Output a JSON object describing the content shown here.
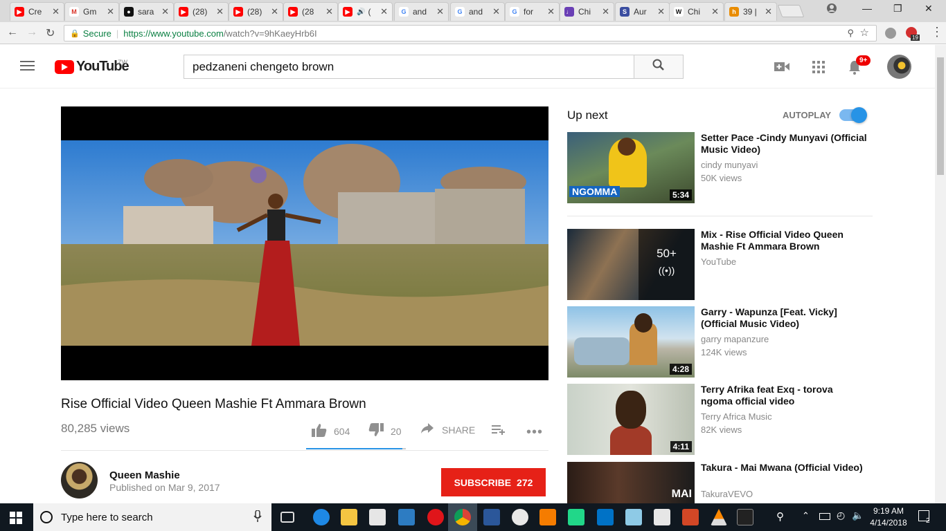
{
  "browser": {
    "tabs": [
      {
        "title": "Cre",
        "fav": "youtube-red"
      },
      {
        "title": "Gm",
        "fav": "gmail"
      },
      {
        "title": "sara",
        "fav": "github"
      },
      {
        "title": "(28)",
        "fav": "youtube-red"
      },
      {
        "title": "(28)",
        "fav": "youtube-red"
      },
      {
        "title": "(28",
        "fav": "youtube-red"
      },
      {
        "title": "(",
        "fav": "youtube-red"
      },
      {
        "title": "and",
        "fav": "google"
      },
      {
        "title": "and",
        "fav": "google"
      },
      {
        "title": "for",
        "fav": "google"
      },
      {
        "title": "Chi",
        "fav": "purple"
      },
      {
        "title": "Aur",
        "fav": "s-blue"
      },
      {
        "title": "Chi",
        "fav": "wikipedia"
      },
      {
        "title": "39 |",
        "fav": "orange"
      }
    ],
    "secure_label": "Secure",
    "url_host": "https://www.youtube.com",
    "url_path": "/watch?v=9hKaeyHrb6I",
    "ext_badge": "19"
  },
  "youtube": {
    "logo_text": "YouTube",
    "country": "ZW",
    "search_value": "pedzaneni chengeto brown",
    "notif_count": "9+"
  },
  "video": {
    "title": "Rise Official Video Queen Mashie Ft Ammara Brown",
    "views": "80,285 views",
    "likes": "604",
    "dislikes": "20",
    "share_label": "SHARE",
    "like_ratio": 0.968,
    "channel": "Queen Mashie",
    "published": "Published on Mar 9, 2017",
    "subscribe_label": "SUBSCRIBE",
    "subscribers": "272"
  },
  "sidebar": {
    "up_next_label": "Up next",
    "autoplay_label": "AUTOPLAY",
    "autoplay_on": true,
    "items": [
      {
        "title": "Setter Pace -Cindy Munyavi (Official Music Video)",
        "channel": "cindy munyavi",
        "views": "50K views",
        "duration": "5:34",
        "thumb_text": "NGOMMA"
      },
      {
        "title": "Mix - Rise Official Video Queen Mashie Ft Ammara Brown",
        "channel": "YouTube",
        "views": "",
        "duration": "",
        "playlist_count": "50+"
      },
      {
        "title": "Garry - Wapunza [Feat. Vicky] (Official Music Video)",
        "channel": "garry mapanzure",
        "views": "124K views",
        "duration": "4:28"
      },
      {
        "title": "Terry Afrika feat Exq - torova ngoma official video",
        "channel": "Terry Africa Music",
        "views": "82K views",
        "duration": "4:11"
      },
      {
        "title": "Takura - Mai Mwana (Official Video)",
        "channel": "TakuraVEVO",
        "views": "",
        "duration": "",
        "thumb_text": "MAI"
      }
    ]
  },
  "taskbar": {
    "search_placeholder": "Type here to search",
    "time": "9:19 AM",
    "date": "4/14/2018",
    "notif_count": "2"
  }
}
